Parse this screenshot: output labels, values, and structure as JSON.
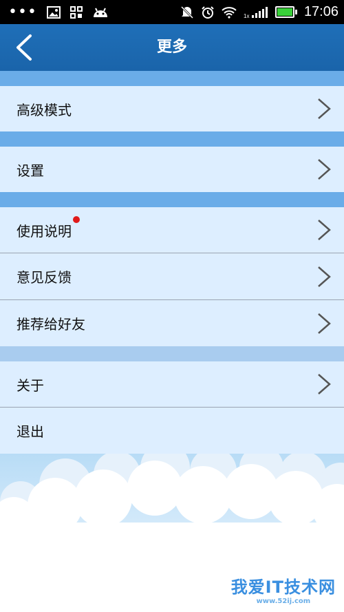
{
  "statusbar": {
    "time": "17:06",
    "signal_label": "1x",
    "icons": [
      "more-dots-icon",
      "image-icon",
      "grid-icon",
      "android-icon",
      "mute-icon",
      "alarm-icon",
      "wifi-icon",
      "signal-icon",
      "battery-icon"
    ]
  },
  "header": {
    "title": "更多",
    "back_icon": "chevron-left-icon"
  },
  "menu": {
    "advanced_mode": "高级模式",
    "settings": "设置",
    "instructions": "使用说明",
    "feedback": "意见反馈",
    "recommend": "推荐给好友",
    "about": "关于",
    "logout": "退出"
  },
  "colors": {
    "titlebar": "#1a64aa",
    "row_bg": "#ddeeff",
    "separator": "#6aace8",
    "badge": "#e01a1a"
  },
  "watermark": {
    "main": "我爱IT技术网",
    "sub": "www.52ij.com"
  }
}
